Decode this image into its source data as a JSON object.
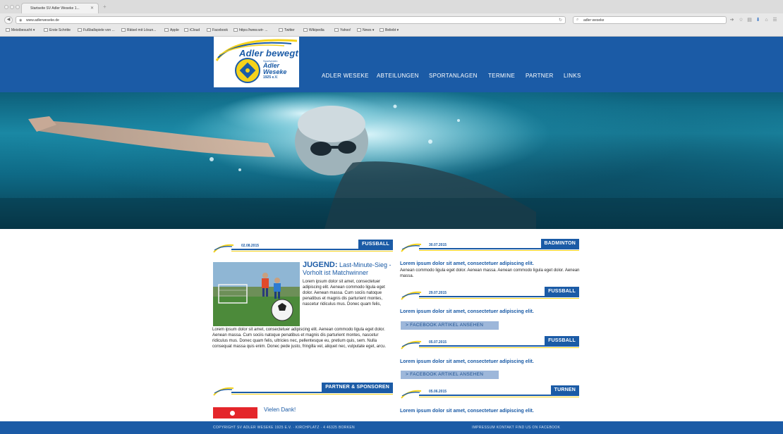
{
  "browser": {
    "tab_title": "Startseite SV Adler Weseke 1...",
    "url": "www.adlerweseke.de",
    "search_value": "adler weseke",
    "bookmarks": [
      "Meistbesucht ▾",
      "Erste Schritte",
      "Fußballspiele von ...",
      "Rätsel mit Lösun...",
      "Apple",
      "iCloud",
      "Facebook",
      "https://www.wir- ...",
      "Twitter",
      "Wikipedia",
      "Yahoo!",
      "News ▾",
      "Beliebt ▾"
    ]
  },
  "site": {
    "logo": {
      "title": "Adler bewegt",
      "subtitle": "Sportverein",
      "name_line1": "Adler",
      "name_line2": "Weseke",
      "year": "1925 e.V."
    },
    "nav": [
      "ADLER WESEKE",
      "ABTEILUNGEN",
      "SPORTANLAGEN",
      "TERMINE",
      "PARTNER",
      "LINKS"
    ]
  },
  "main_article": {
    "date": "02.08.2015",
    "category": "FUSSBALL",
    "title_lead": "JUGEND:",
    "title_rest": " Last-Minute-Sieg - Vorholt ist Matchwinner",
    "body_right": "Lorem ipsum dolor sit amet, consectetuer adipiscing elit. Aenean commodo ligula eget dolor. Aenean massa. Cum sociis natoque penatibus et magnis dis parturient montes, nascetur ridiculus mus. Donec quam felis,",
    "body_full": "Lorem ipsum dolor sit amet, consectetuer adipiscing elit. Aenean commodo ligula eget dolor. Aenean massa. Cum sociis natoque penatibus et magnis dis parturient montes, nascetur ridiculus mus. Donec quam felis, ultricies nec, pellentesque eu, pretium quis, sem. Nulla consequat massa quis enim. Donec pede justo, fringilla vel, aliquet nec, vulputate eget, arcu."
  },
  "partners": {
    "heading": "PARTNER & SPONSOREN",
    "thanks": "Vielen Dank!"
  },
  "news": [
    {
      "date": "30.07.2015",
      "category": "BADMINTON",
      "title": "Lorem ipsum dolor sit amet, consectetuer adipiscing elit.",
      "body": "Aenean commodo ligula eget dolor. Aenean massa. Aenean commodo ligula eget dolor. Aenean massa."
    },
    {
      "date": "29.07.2015",
      "category": "FUSSBALL",
      "title": "Lorem ipsum dolor sit amet, consectetuer adipiscing elit.",
      "button": "> FACEBOOK ARTIKEL ANSEHEN"
    },
    {
      "date": "05.07.2015",
      "category": "FUSSBALL",
      "title": "Lorem ipsum dolor sit amet, consectetuer adipiscing elit.",
      "button": "> FACEBOOK ARTIKEL ANSEHEN"
    },
    {
      "date": "05.06.2015",
      "category": "TURNEN",
      "title": "Lorem ipsum dolor sit amet, consectetuer adipiscing elit."
    }
  ],
  "footer": {
    "copyright": "COPYRIGHT SV ADLER WESEKE 1925 E.V. · KIRCHPLATZ · 4 46325 BORKEN",
    "links": "IMPRESSUM    KONTAKT    FIND US ON FACEBOOK"
  },
  "colors": {
    "brand_blue": "#1b5ba6",
    "accent_yellow": "#f5d21a",
    "button_light_blue": "#9db7da"
  }
}
